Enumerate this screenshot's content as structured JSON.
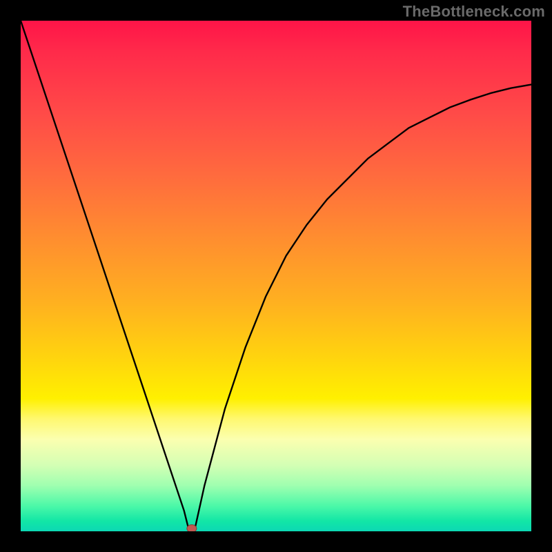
{
  "watermark": "TheBottleneck.com",
  "chart_data": {
    "type": "line",
    "title": "",
    "xlabel": "",
    "ylabel": "",
    "xlim": [
      0,
      100
    ],
    "ylim": [
      0,
      100
    ],
    "grid": false,
    "legend": false,
    "marker": {
      "x": 33.5,
      "y": 0,
      "color": "#c05a52"
    },
    "series": [
      {
        "name": "curve",
        "color": "#000000",
        "x": [
          0,
          4,
          8,
          12,
          16,
          20,
          24,
          28,
          30,
          32,
          33,
          34,
          36,
          40,
          44,
          48,
          52,
          56,
          60,
          64,
          68,
          72,
          76,
          80,
          84,
          88,
          92,
          96,
          100
        ],
        "y": [
          100,
          88,
          76,
          64,
          52,
          40,
          28,
          16,
          10,
          4,
          0,
          0,
          9,
          24,
          36,
          46,
          54,
          60,
          65,
          69,
          73,
          76,
          79,
          81,
          83,
          84.5,
          85.8,
          86.8,
          87.5
        ]
      }
    ],
    "gradient_stops": [
      {
        "pos": 0.0,
        "color": "#ff1448"
      },
      {
        "pos": 0.3,
        "color": "#ff6a3e"
      },
      {
        "pos": 0.55,
        "color": "#ffb020"
      },
      {
        "pos": 0.74,
        "color": "#fff000"
      },
      {
        "pos": 0.87,
        "color": "#d4ffb4"
      },
      {
        "pos": 1.0,
        "color": "#0cd8b4"
      }
    ]
  }
}
